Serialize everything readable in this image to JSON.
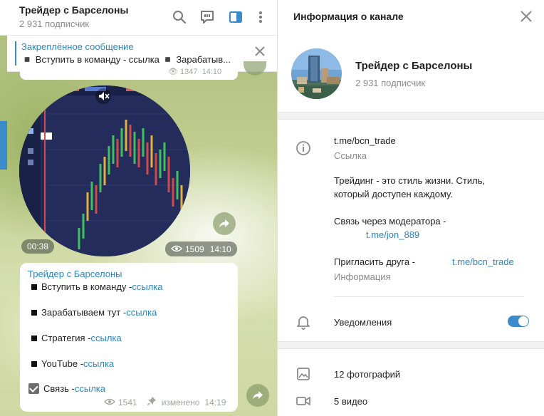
{
  "chat": {
    "title": "Трейдер с Барселоны",
    "subtitle": "2 931 подписчик",
    "pinned": {
      "title": "Закреплённое сообщение",
      "text": "◾ Вступить в команду - ссылка   ◾ Зарабатыв..."
    },
    "previous_message_meta": {
      "views": "1347",
      "time": "14:10"
    },
    "video_message": {
      "duration": "00:38",
      "views": "1509",
      "time": "14:10"
    },
    "post": {
      "sender": "Трейдер с Барселоны",
      "lines": [
        {
          "text": "Вступить в команду - ",
          "link": "ссылка"
        },
        {
          "text": "Зарабатываем тут - ",
          "link": "ссылка"
        },
        {
          "text": "Стратегия - ",
          "link": "ссылка"
        },
        {
          "text": "YouTube - ",
          "link": "ссылка"
        },
        {
          "text": "Связь - ",
          "link": "ссылка"
        }
      ],
      "views": "1541",
      "edited_label": "изменено",
      "time": "14:19"
    }
  },
  "info": {
    "header_title": "Информация о канале",
    "channel_name": "Трейдер с Барселоны",
    "subscribers": "2 931 подписчик",
    "link": "t.me/bcn_trade",
    "link_caption": "Ссылка",
    "description_line1": "Трейдинг - это стиль жизни. Стиль,",
    "description_line2": "который доступен каждому.",
    "contact_label": "Связь через модератора -",
    "contact_link": "t.me/jon_889",
    "invite_label": "Пригласить друга -",
    "invite_link": "t.me/bcn_trade",
    "info_caption": "Информация",
    "notifications_label": "Уведомления",
    "notifications_on": true,
    "photos": "12 фотографий",
    "videos": "5 видео"
  },
  "colors": {
    "accent": "#3a8bc9",
    "link": "#2b87c4",
    "muted": "#8a8a8a"
  },
  "icons": [
    "search-icon",
    "discussion-icon",
    "sidebar-toggle-icon",
    "more-icon",
    "close-icon",
    "mute-icon",
    "share-icon",
    "eye-icon",
    "pin-icon",
    "info-icon",
    "bell-icon",
    "photo-icon",
    "video-icon"
  ]
}
